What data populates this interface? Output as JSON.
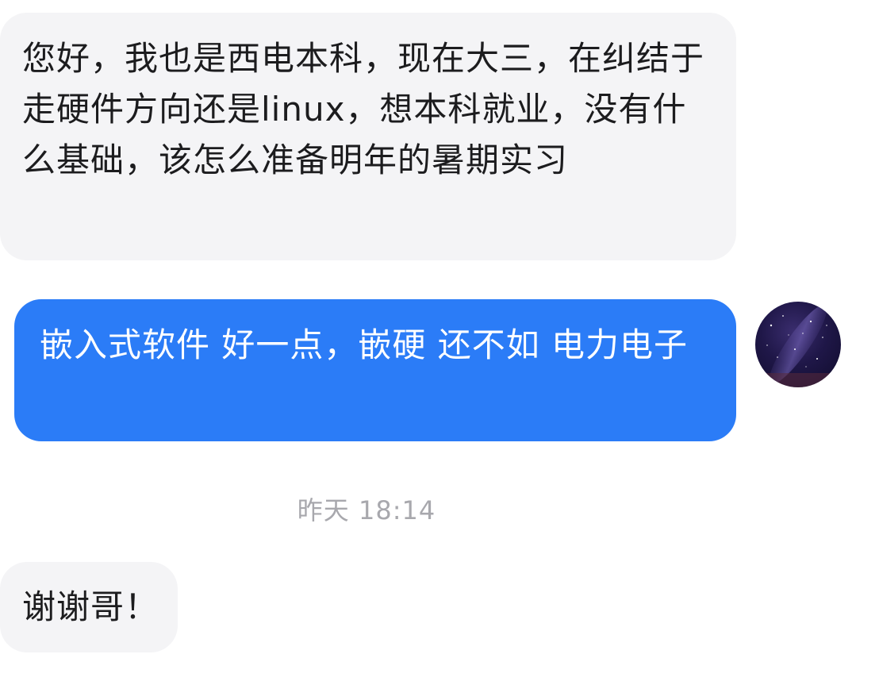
{
  "messages": [
    {
      "id": "msg1",
      "direction": "incoming",
      "text": "您好，我也是西电本科，现在大三，在纠结于走硬件方向还是linux，想本科就业，没有什么基础，该怎么准备明年的暑期实习"
    },
    {
      "id": "msg2",
      "direction": "outgoing",
      "text": "嵌入式软件 好一点，嵌硬 还不如 电力电子"
    },
    {
      "id": "msg3",
      "direction": "incoming",
      "text": "谢谢哥！"
    }
  ],
  "timestamp": "昨天 18:14",
  "avatar": {
    "icon": "starry-night-sky-avatar"
  },
  "colors": {
    "outgoing_bubble": "#2b7cf7",
    "incoming_bubble": "#f4f4f6",
    "timestamp_text": "#a8a8ad"
  }
}
